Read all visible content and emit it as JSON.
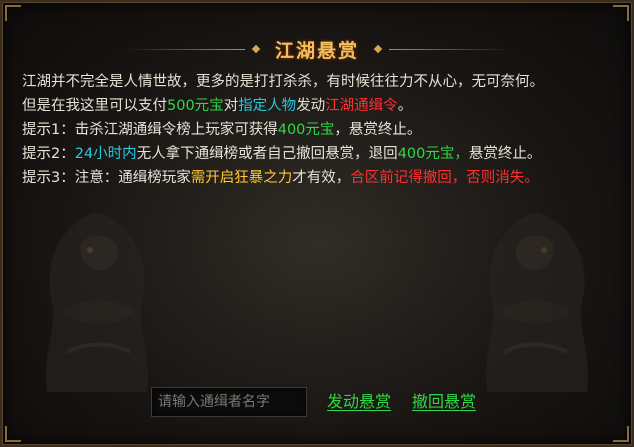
{
  "dialog": {
    "title": "江湖悬赏"
  },
  "description": {
    "line1": "江湖并不完全是人情世故，更多的是打打杀杀，有时候往往力不从心，无可奈何。",
    "line2": {
      "p1": "但是在我这里可以支付",
      "amount": "500元宝",
      "p2": "对",
      "target": "指定人物",
      "p3": "发动",
      "order": "江湖通缉令",
      "p4": "。"
    },
    "tip1": {
      "label": "提示1：",
      "p1": "击杀江湖通缉令榜上玩家可获得",
      "reward": "400元宝",
      "p2": "，悬赏终止。"
    },
    "tip2": {
      "label": "提示2：",
      "time": "24小时内",
      "p1": "无人拿下通缉榜或者自己撤回悬赏，退回",
      "refund": "400元宝",
      "comma": "，",
      "p2": "悬赏终止。"
    },
    "tip3": {
      "label": "提示3：",
      "p1": "注意：通缉榜玩家",
      "condition": "需开启狂暴之力",
      "p2": "才有效，",
      "warning": "合区前记得撤回，否则消失。"
    }
  },
  "controls": {
    "input_placeholder": "请输入通缉者名字",
    "input_value": "",
    "issue_label": "发动悬赏",
    "revoke_label": "撤回悬赏"
  },
  "colors": {
    "green": "#2fd846",
    "cyan": "#28c8e0",
    "red": "#ff3030",
    "yellow": "#ffc830",
    "title": "#f0c060"
  }
}
